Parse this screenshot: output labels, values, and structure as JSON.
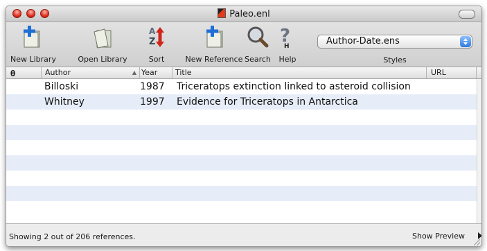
{
  "window": {
    "title": "Paleo.enl",
    "accent": "#2f7ae0"
  },
  "toolbar": {
    "items": [
      {
        "label": "New Library",
        "icon": "new-library-icon"
      },
      {
        "label": "Open Library",
        "icon": "open-library-icon"
      },
      {
        "label": "Sort",
        "icon": "sort-icon"
      },
      {
        "label": "New Reference",
        "icon": "new-reference-icon"
      },
      {
        "label": "Search",
        "icon": "search-icon"
      },
      {
        "label": "Help",
        "icon": "help-icon"
      }
    ],
    "style_select": {
      "value": "Author-Date.ens",
      "label": "Styles"
    }
  },
  "table": {
    "columns": [
      "Author",
      "Year",
      "Title",
      "URL"
    ],
    "rows": [
      {
        "author": "Billoski",
        "year": "1987",
        "title": "Triceratops extinction linked to asteroid collision"
      },
      {
        "author": "Whitney",
        "year": "1997",
        "title": "Evidence for Triceratops in Antarctica"
      }
    ]
  },
  "status": {
    "text": "Showing 2 out of 206 references.",
    "preview_label": "Show Preview"
  }
}
